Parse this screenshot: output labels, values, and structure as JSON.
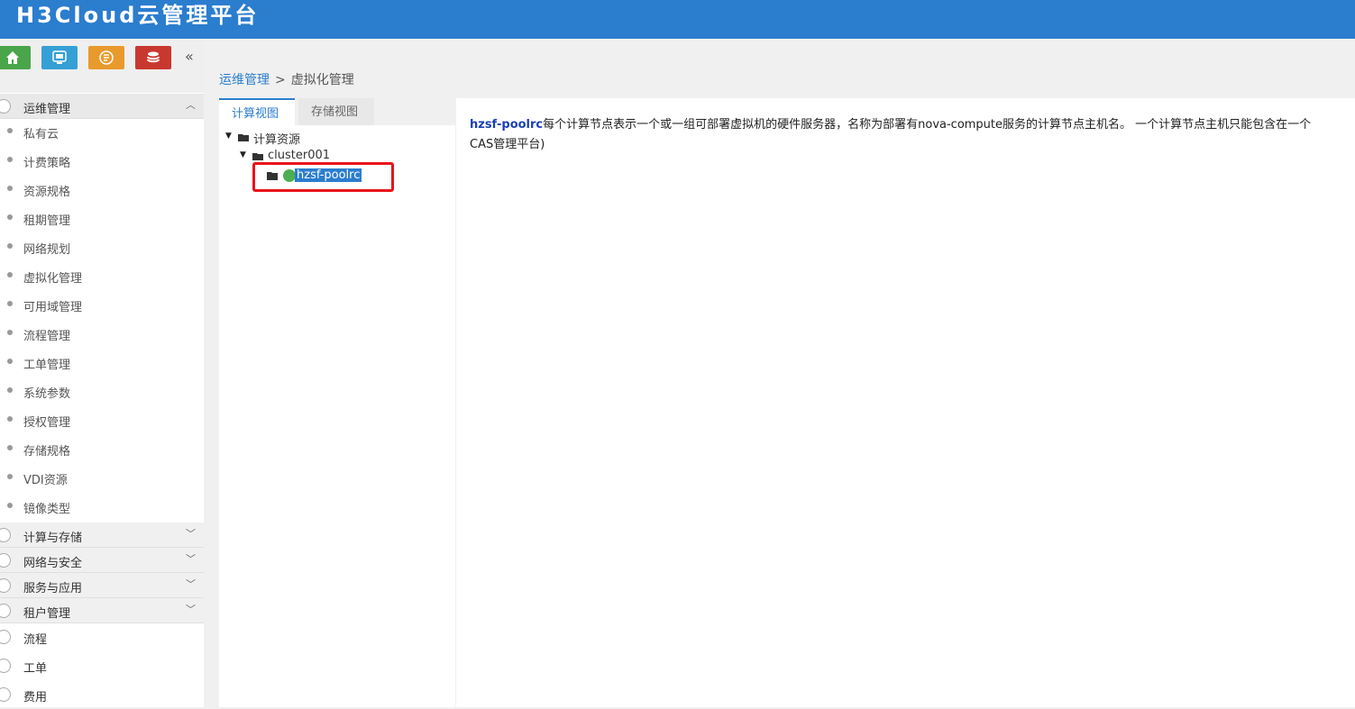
{
  "app": {
    "title": "H3Cloud云管理平台"
  },
  "quickbar": {
    "collapse": "«"
  },
  "sidebar": {
    "groups": [
      {
        "label": "运维管理",
        "expanded": true
      },
      {
        "label": "计算与存储"
      },
      {
        "label": "网络与安全"
      },
      {
        "label": "服务与应用"
      },
      {
        "label": "租户管理"
      }
    ],
    "ops_items": [
      "私有云",
      "计费策略",
      "资源规格",
      "租期管理",
      "网络规划",
      "虚拟化管理",
      "可用域管理",
      "流程管理",
      "工单管理",
      "系统参数",
      "授权管理",
      "存储规格",
      "VDI资源",
      "镜像类型"
    ],
    "plain_items": [
      "流程",
      "工单",
      "费用"
    ]
  },
  "breadcrumb": {
    "parent": "运维管理",
    "separator": ">",
    "current": "虚拟化管理"
  },
  "tabs": {
    "compute": "计算视图",
    "storage": "存储视图"
  },
  "tree": {
    "root": "计算资源",
    "cluster": "cluster001",
    "host": "hzsf-poolrc"
  },
  "content": {
    "host": "hzsf-poolrc",
    "line1": "每个计算节点表示一个或一组可部署虚拟机的硬件服务器，名称为部署有nova-compute服务的计算节点主机名。 一个计算节点主机只能包含在一个",
    "line2": "CAS管理平台)"
  },
  "colors": {
    "topbar": "#2b7dce",
    "accent": "#2b7dce",
    "highlight": "#e8141b"
  }
}
